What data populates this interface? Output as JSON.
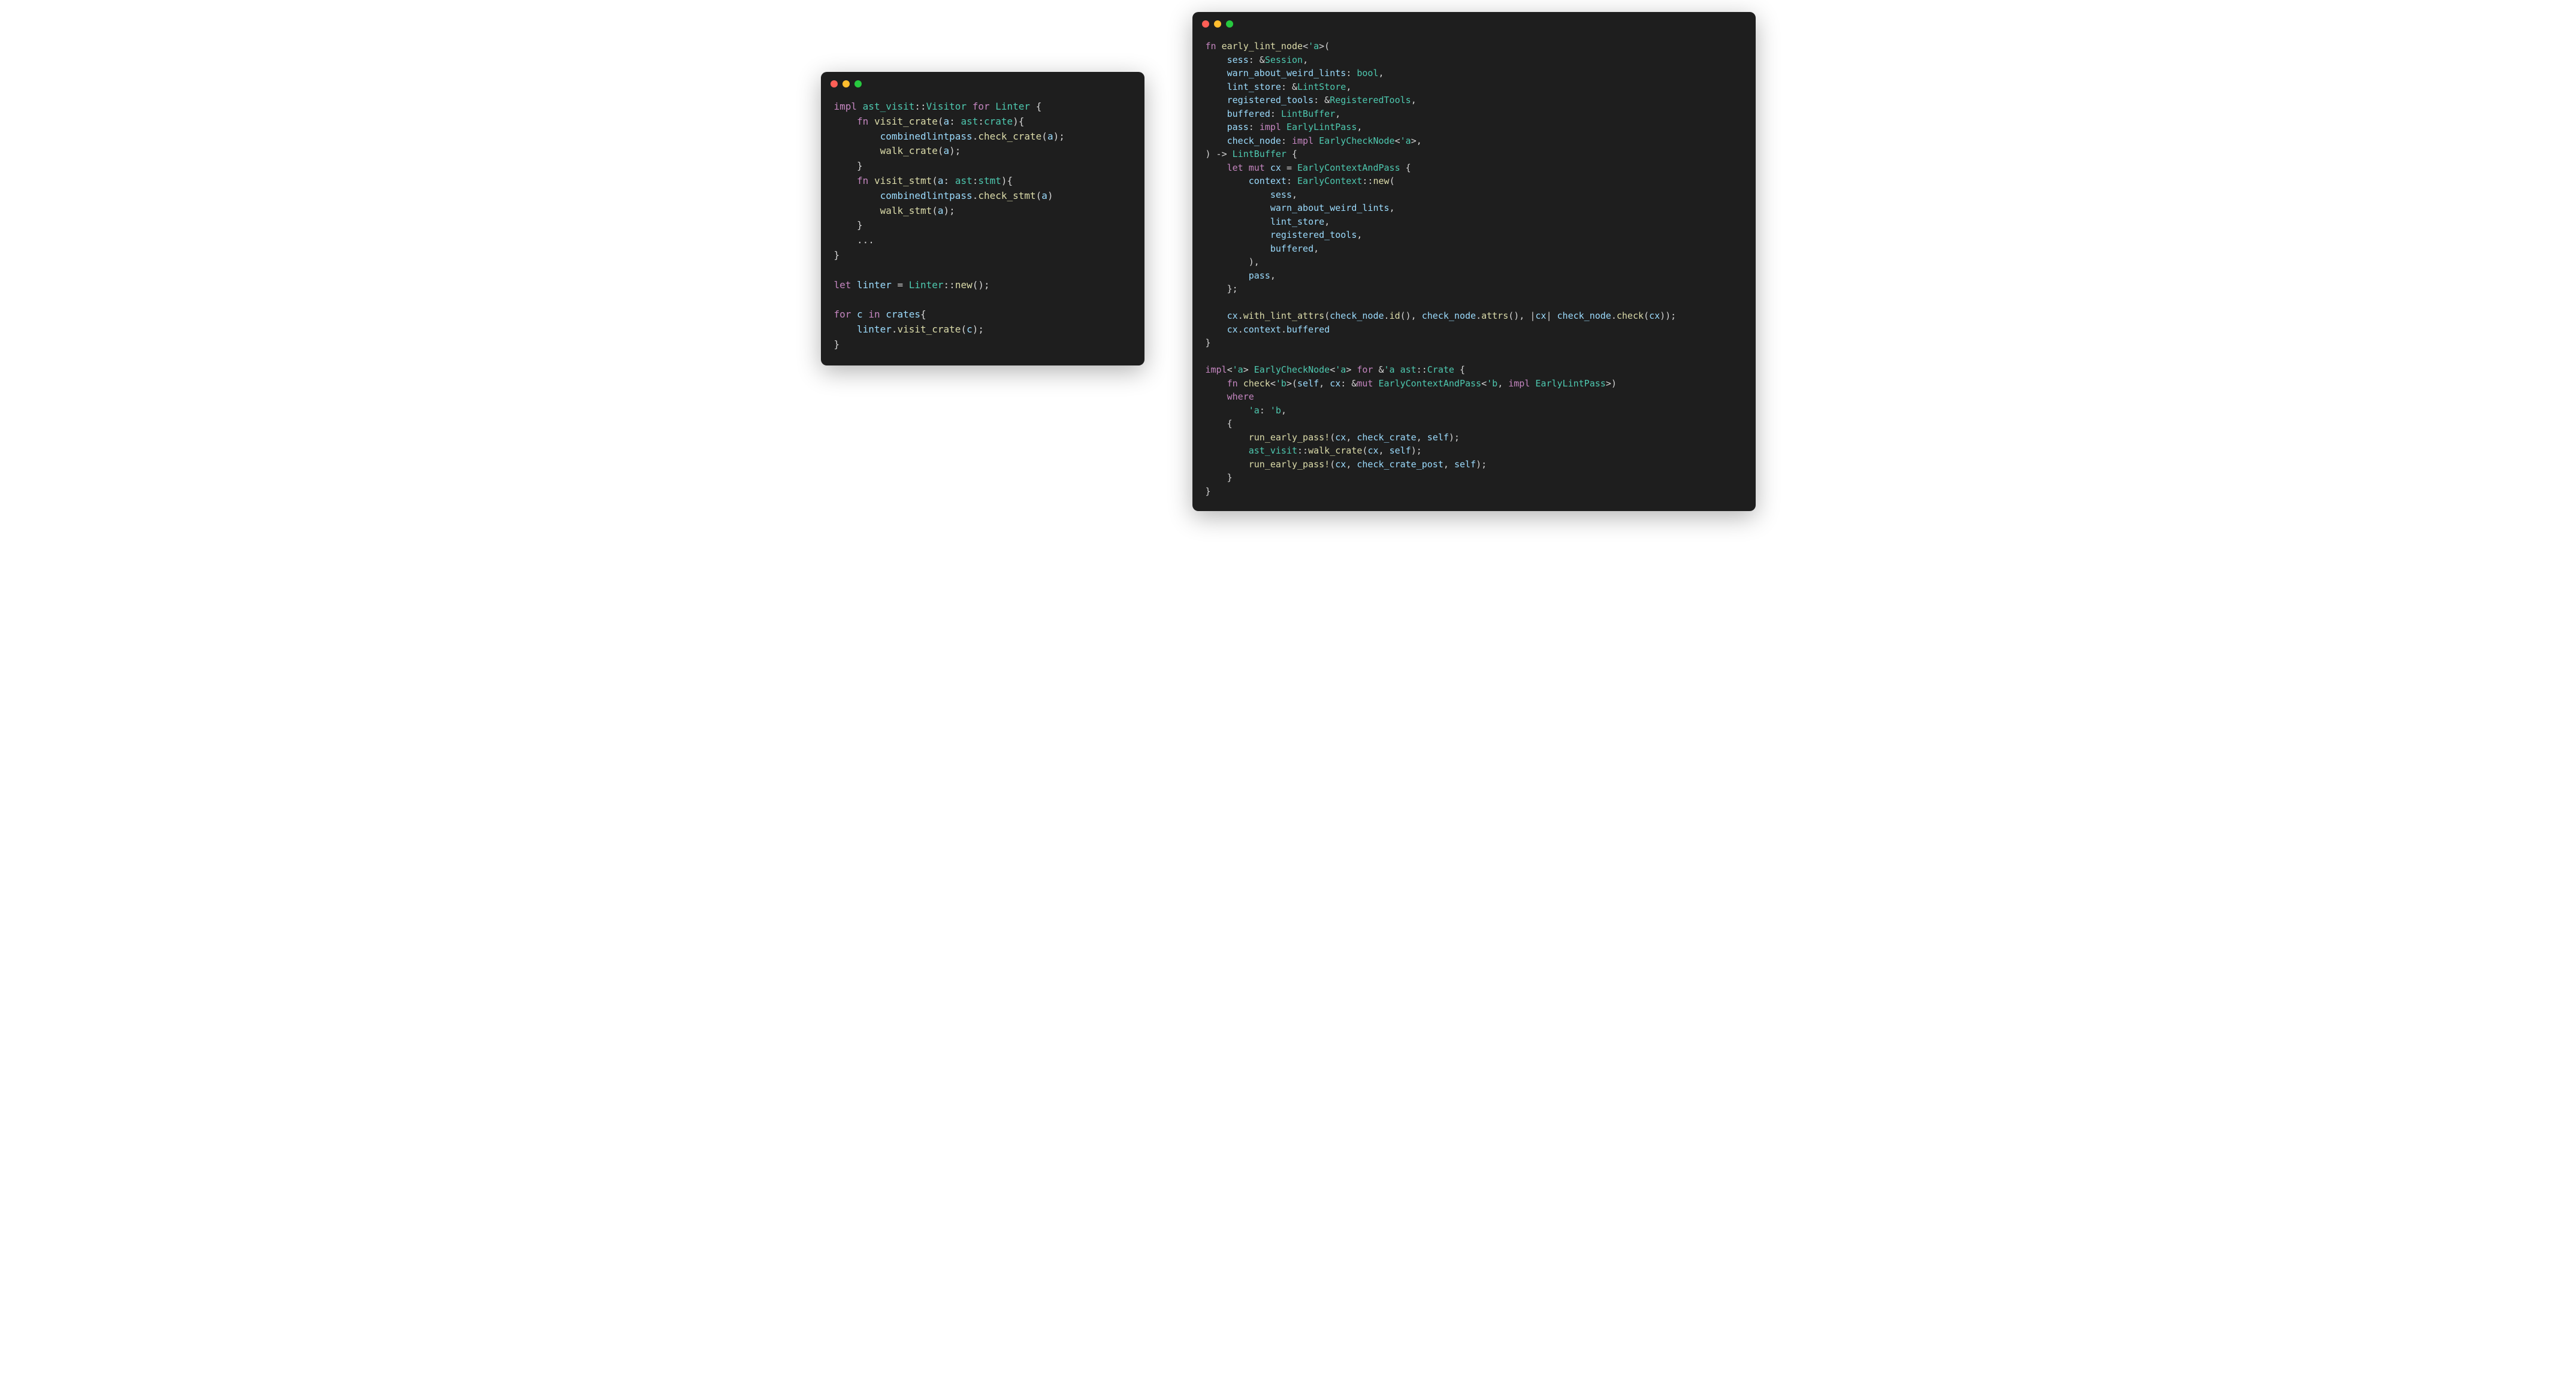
{
  "left": {
    "code_html": "<span class=\"kw\">impl</span> <span class=\"ns\">ast_visit</span>::<span class=\"type\">Visitor</span> <span class=\"kw\">for</span> <span class=\"type\">Linter</span> {\n    <span class=\"kw\">fn</span> <span class=\"fn-name\">visit_crate</span>(<span class=\"var\">a</span>: <span class=\"ns\">ast</span>:<span class=\"type\">crate</span>){\n        <span class=\"var\">combinedlintpass</span>.<span class=\"fn-name\">check_crate</span>(<span class=\"var\">a</span>);\n        <span class=\"fn-name\">walk_crate</span>(<span class=\"var\">a</span>);\n    }\n    <span class=\"kw\">fn</span> <span class=\"fn-name\">visit_stmt</span>(<span class=\"var\">a</span>: <span class=\"ns\">ast</span>:<span class=\"type\">stmt</span>){\n        <span class=\"var\">combinedlintpass</span>.<span class=\"fn-name\">check_stmt</span>(<span class=\"var\">a</span>)\n        <span class=\"fn-name\">walk_stmt</span>(<span class=\"var\">a</span>);\n    }\n    ...\n}\n\n<span class=\"kw\">let</span> <span class=\"var\">linter</span> = <span class=\"type\">Linter</span>::<span class=\"fn-name\">new</span>();\n\n<span class=\"kw\">for</span> <span class=\"var\">c</span> <span class=\"kw\">in</span> <span class=\"var\">crates</span>{\n    <span class=\"var\">linter</span>.<span class=\"fn-name\">visit_crate</span>(<span class=\"var\">c</span>);\n}"
  },
  "right": {
    "code_html": "<span class=\"kw\">fn</span> <span class=\"fn-name\">early_lint_node</span>&lt;<span class=\"lt\">'a</span>&gt;(\n    <span class=\"var\">sess</span>: &amp;<span class=\"type\">Session</span>,\n    <span class=\"var\">warn_about_weird_lints</span>: <span class=\"type\">bool</span>,\n    <span class=\"var\">lint_store</span>: &amp;<span class=\"type\">LintStore</span>,\n    <span class=\"var\">registered_tools</span>: &amp;<span class=\"type\">RegisteredTools</span>,\n    <span class=\"var\">buffered</span>: <span class=\"type\">LintBuffer</span>,\n    <span class=\"var\">pass</span>: <span class=\"kw\">impl</span> <span class=\"type\">EarlyLintPass</span>,\n    <span class=\"var\">check_node</span>: <span class=\"kw\">impl</span> <span class=\"type\">EarlyCheckNode</span>&lt;<span class=\"lt\">'a</span>&gt;,\n) -&gt; <span class=\"type\">LintBuffer</span> {\n    <span class=\"kw\">let</span> <span class=\"kw\">mut</span> <span class=\"var\">cx</span> = <span class=\"type\">EarlyContextAndPass</span> {\n        <span class=\"var\">context</span>: <span class=\"type\">EarlyContext</span>::<span class=\"fn-name\">new</span>(\n            <span class=\"var\">sess</span>,\n            <span class=\"var\">warn_about_weird_lints</span>,\n            <span class=\"var\">lint_store</span>,\n            <span class=\"var\">registered_tools</span>,\n            <span class=\"var\">buffered</span>,\n        ),\n        <span class=\"var\">pass</span>,\n    };\n\n    <span class=\"var\">cx</span>.<span class=\"fn-name\">with_lint_attrs</span>(<span class=\"var\">check_node</span>.<span class=\"fn-name\">id</span>(), <span class=\"var\">check_node</span>.<span class=\"fn-name\">attrs</span>(), |<span class=\"var\">cx</span>| <span class=\"var\">check_node</span>.<span class=\"fn-name\">check</span>(<span class=\"var\">cx</span>));\n    <span class=\"var\">cx</span>.<span class=\"var\">context</span>.<span class=\"var\">buffered</span>\n}\n\n<span class=\"kw\">impl</span>&lt;<span class=\"lt\">'a</span>&gt; <span class=\"type\">EarlyCheckNode</span>&lt;<span class=\"lt\">'a</span>&gt; <span class=\"kw\">for</span> &amp;<span class=\"lt\">'a</span> <span class=\"ns\">ast</span>::<span class=\"type\">Crate</span> {\n    <span class=\"kw\">fn</span> <span class=\"fn-name\">check</span>&lt;<span class=\"lt\">'b</span>&gt;(<span class=\"var\">self</span>, <span class=\"var\">cx</span>: &amp;<span class=\"kw\">mut</span> <span class=\"type\">EarlyContextAndPass</span>&lt;<span class=\"lt\">'b</span>, <span class=\"kw\">impl</span> <span class=\"type\">EarlyLintPass</span>&gt;)\n    <span class=\"kw\">where</span>\n        <span class=\"lt\">'a</span>: <span class=\"lt\">'b</span>,\n    {\n        <span class=\"macro\">run_early_pass!</span>(<span class=\"var\">cx</span>, <span class=\"var\">check_crate</span>, <span class=\"var\">self</span>);\n        <span class=\"ns\">ast_visit</span>::<span class=\"fn-name\">walk_crate</span>(<span class=\"var\">cx</span>, <span class=\"var\">self</span>);\n        <span class=\"macro\">run_early_pass!</span>(<span class=\"var\">cx</span>, <span class=\"var\">check_crate_post</span>, <span class=\"var\">self</span>);\n    }\n}"
  },
  "colors": {
    "background": "#1e1e1e",
    "keyword": "#c586c0",
    "function": "#dcdcaa",
    "type": "#4ec9b0",
    "variable": "#9cdcfe",
    "default": "#d4d4d4",
    "red": "#ff5f56",
    "yellow": "#ffbd2e",
    "green": "#27c93f"
  }
}
